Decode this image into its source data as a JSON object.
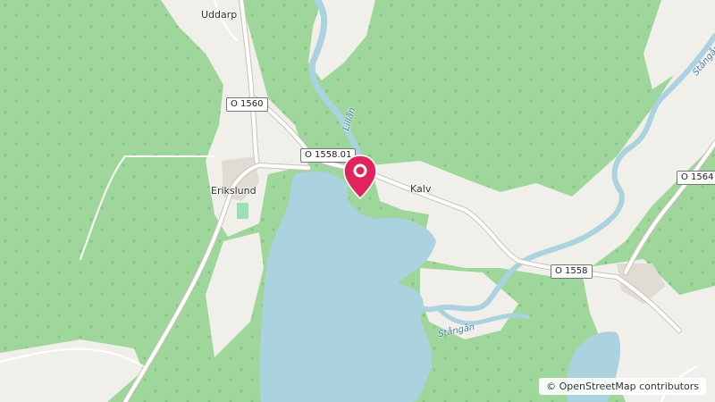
{
  "map": {
    "places": {
      "uddarp": "Uddarp",
      "erikslund": "Erikslund",
      "kalv": "Kalv"
    },
    "roads": {
      "o1560": "O 1560",
      "o155801": "O 1558.01",
      "o1558": "O 1558",
      "o1564": "O 1564"
    },
    "waterways": {
      "lillan": "Lillån",
      "stangan_1": "Stångån",
      "stangan_2": "Stångån"
    },
    "attribution": "© OpenStreetMap contributors",
    "marker_icon": "map-pin-icon",
    "colors": {
      "forest": "#9fd69b",
      "meadow": "#f1efe9",
      "water": "#aad3df",
      "marker": "#e0245e"
    }
  }
}
